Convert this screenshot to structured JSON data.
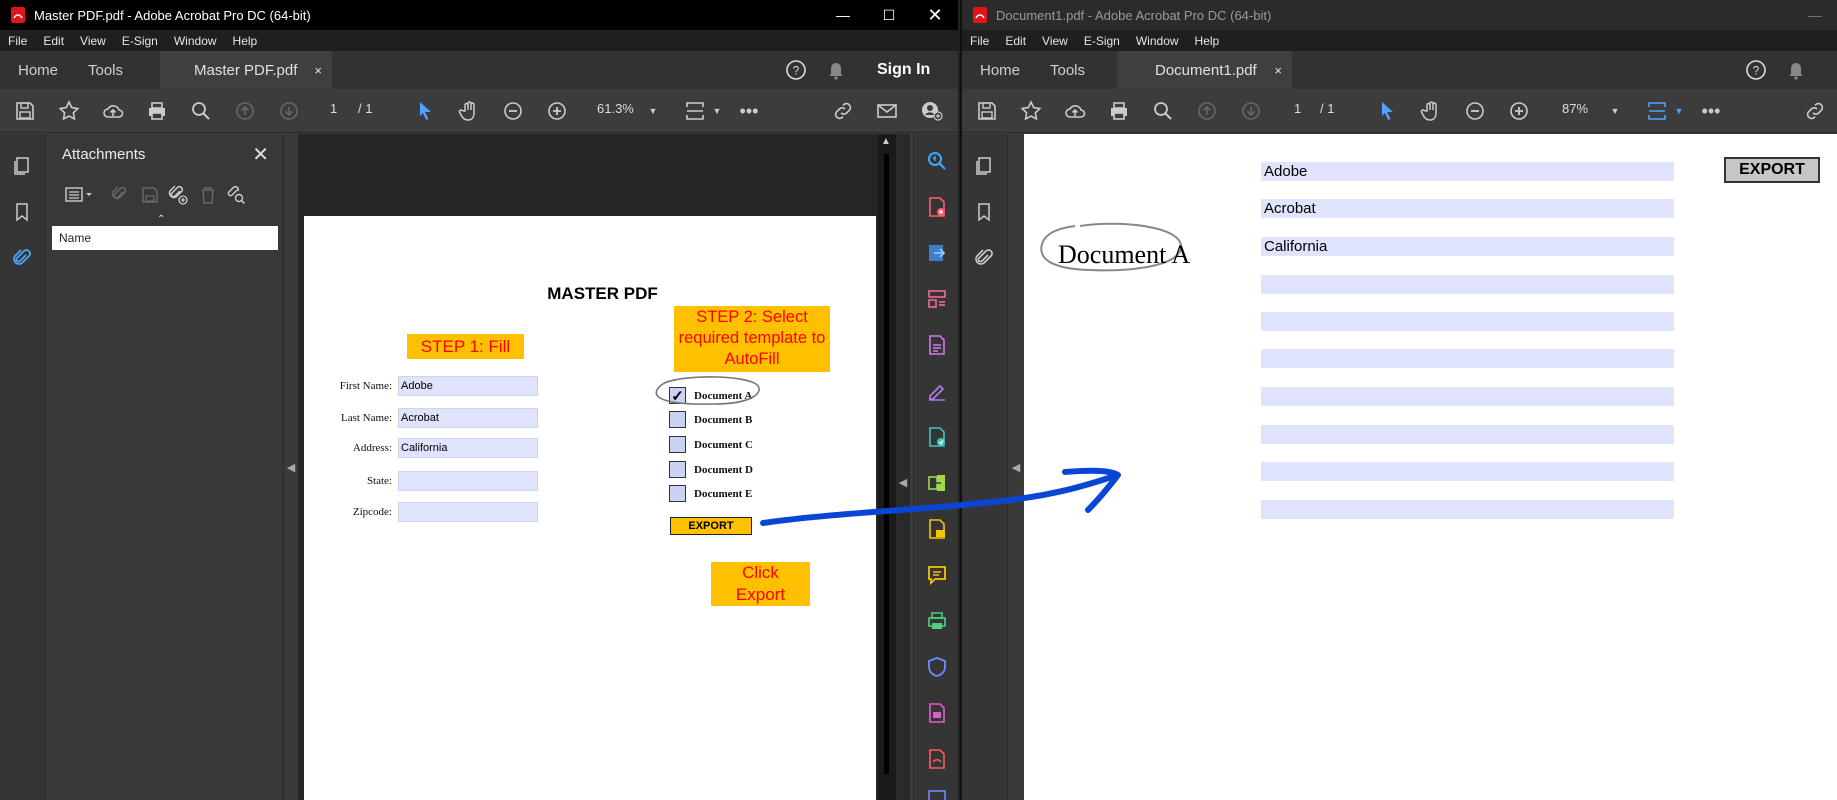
{
  "window1": {
    "title": "Master PDF.pdf - Adobe Acrobat Pro DC (64-bit)",
    "menu": [
      "File",
      "Edit",
      "View",
      "E-Sign",
      "Window",
      "Help"
    ],
    "tabs": {
      "home": "Home",
      "tools": "Tools",
      "doc": "Master PDF.pdf",
      "close": "×"
    },
    "sign_in": "Sign In",
    "page_current": "1",
    "page_total": "/ 1",
    "zoom": "61.3%",
    "attachments": {
      "title": "Attachments",
      "column_name": "Name"
    },
    "document": {
      "heading": "MASTER PDF",
      "step1": "STEP 1: Fill",
      "step2": "STEP 2: Select required template to AutoFill",
      "fields": [
        {
          "label": "First Name:",
          "value": "Adobe"
        },
        {
          "label": "Last Name:",
          "value": "Acrobat"
        },
        {
          "label": "Address:",
          "value": "California"
        },
        {
          "label": "State:",
          "value": ""
        },
        {
          "label": "Zipcode:",
          "value": ""
        }
      ],
      "templates": [
        {
          "label": "Document A",
          "checked": true,
          "mark": "✓"
        },
        {
          "label": "Document B",
          "checked": false,
          "mark": ""
        },
        {
          "label": "Document C",
          "checked": false,
          "mark": ""
        },
        {
          "label": "Document D",
          "checked": false,
          "mark": ""
        },
        {
          "label": "Document E",
          "checked": false,
          "mark": ""
        }
      ],
      "export_button": "EXPORT",
      "click_export": "Click Export"
    }
  },
  "window2": {
    "title": "Document1.pdf - Adobe Acrobat Pro DC (64-bit)",
    "menu": [
      "File",
      "Edit",
      "View",
      "E-Sign",
      "Window",
      "Help"
    ],
    "tabs": {
      "home": "Home",
      "tools": "Tools",
      "doc": "Document1.pdf",
      "close": "×"
    },
    "page_current": "1",
    "page_total": "/ 1",
    "zoom": "87%",
    "document": {
      "title": "Document A",
      "export_button": "EXPORT",
      "fields": [
        "Adobe",
        "Acrobat",
        "California",
        "",
        "",
        "",
        "",
        "",
        "",
        ""
      ]
    }
  },
  "colors": {
    "accent_blue": "#4ea3ff",
    "highlight_yellow": "#ffc000",
    "step_text_red": "#ff0000",
    "field_fill": "#dfe3fb",
    "arrow_blue": "#0a46d6"
  }
}
